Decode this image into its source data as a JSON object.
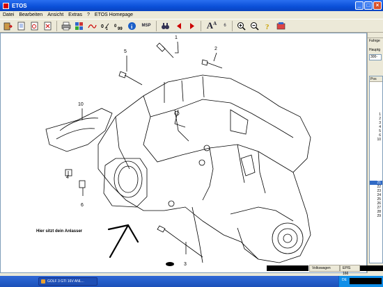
{
  "window": {
    "title": "ETOS",
    "buttons": {
      "minimize": "_",
      "maximize": "□",
      "close": "×"
    }
  },
  "menu": [
    "Datei",
    "Bearbeiten",
    "Ansicht",
    "Extras",
    "?",
    "ETOS Homepage"
  ],
  "toolbar": {
    "icons": [
      "exit-icon",
      "open-icon",
      "catalog-icon",
      "export-icon",
      "print-icon",
      "grid-icon",
      "wave-icon",
      "sort-icon",
      "number-icon",
      "info-icon",
      "msp-icon",
      "binoculars-icon",
      "prev-icon",
      "next-icon",
      "font-size-icon",
      "zoom-in-icon",
      "zoom-out-icon",
      "help-icon",
      "shop-icon"
    ],
    "msp_label": "MSP",
    "font_small": "A",
    "font_big": "A",
    "page_number": "6"
  },
  "diagram": {
    "part_numbers": [
      "1",
      "2",
      "3",
      "4",
      "5",
      "6",
      "10"
    ],
    "caption": "Hier sitzt dein Anlasser"
  },
  "right_pane": {
    "label_fahrgestell": "Fahrge",
    "label_hauptgruppe": "Hauptg",
    "field_value": "300-",
    "pos_header": "Pos",
    "positions": [
      "1",
      "2",
      "3",
      "4",
      "5",
      "6",
      "10",
      "21",
      "22",
      "23",
      "24",
      "25",
      "26",
      "27",
      "28",
      "29"
    ],
    "selected_position": "21"
  },
  "status": {
    "brand": "Volkswagen",
    "epis": "EPIS 166"
  },
  "taskbar": {
    "task_label": "GOLF 3 GTI 16V ANL...",
    "lang": "DE"
  }
}
